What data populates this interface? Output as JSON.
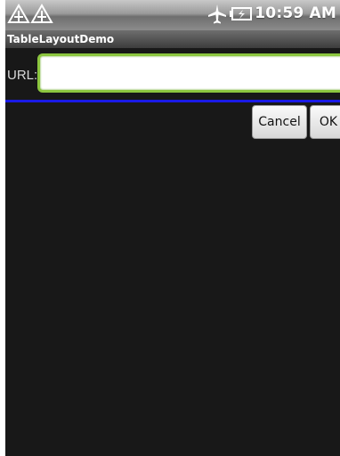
{
  "status_bar": {
    "time": "10:59 AM",
    "icons": [
      "signal-warning-icon",
      "signal-warning-icon",
      "airplane-mode-icon",
      "battery-charging-icon"
    ]
  },
  "app": {
    "title": "TableLayoutDemo"
  },
  "form": {
    "url_label": "URL:",
    "url_value": "",
    "url_placeholder": "",
    "cancel_label": "Cancel",
    "ok_label": "OK"
  },
  "colors": {
    "divider": "#1a1ae6",
    "input_border": "#8cc63f",
    "background": "#181818"
  }
}
